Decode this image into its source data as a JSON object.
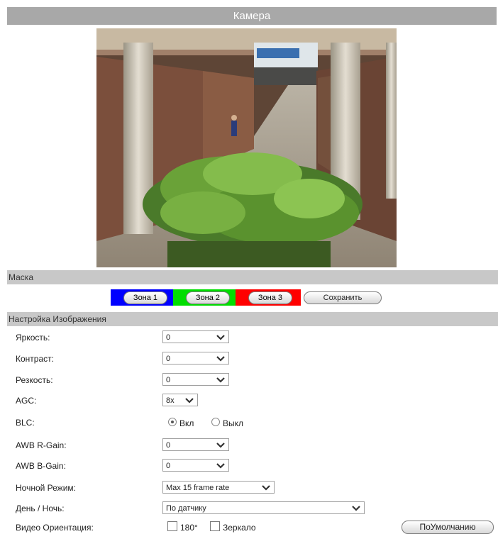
{
  "title": "Камера",
  "mask": {
    "heading": "Маска",
    "zones": [
      {
        "label": "Зона 1",
        "color": "#0000ff"
      },
      {
        "label": "Зона 2",
        "color": "#00dd00"
      },
      {
        "label": "Зона 3",
        "color": "#ff0000"
      }
    ],
    "save_label": "Сохранить"
  },
  "image_settings": {
    "heading": "Настройка Изображения",
    "brightness": {
      "label": "Яркость:",
      "value": "0"
    },
    "contrast": {
      "label": "Контраст:",
      "value": "0"
    },
    "sharpness": {
      "label": "Резкость:",
      "value": "0"
    },
    "agc": {
      "label": "AGC:",
      "value": "8x"
    },
    "blc": {
      "label": "BLC:",
      "on_label": "Вкл",
      "off_label": "Выкл",
      "selected": "on"
    },
    "awb_r": {
      "label": "AWB R-Gain:",
      "value": "0"
    },
    "awb_b": {
      "label": "AWB B-Gain:",
      "value": "0"
    },
    "night_mode": {
      "label": "Ночной Режим:",
      "value": "Max 15 frame rate"
    },
    "day_night": {
      "label": "День / Ночь:",
      "value": "По датчику"
    },
    "orientation": {
      "label": "Видео Ориентация:",
      "opt_180": "180°",
      "opt_mirror": "Зеркало"
    },
    "default_label": "ПоУмолчанию"
  }
}
